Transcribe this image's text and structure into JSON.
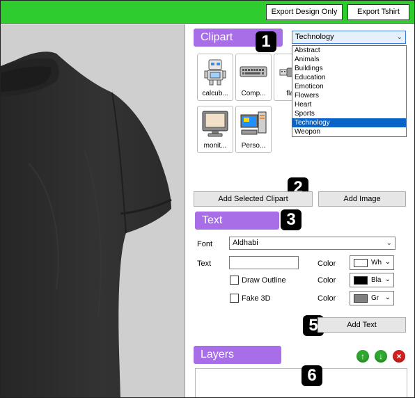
{
  "toolbar": {
    "export_design_label": "Export Design Only",
    "export_tshirt_label": "Export Tshirt"
  },
  "clipart": {
    "header": "Clipart",
    "badge": "1",
    "category_selected": "Technology",
    "categories": [
      "Abstract",
      "Animals",
      "Buildings",
      "Education",
      "Emoticon",
      "Flowers",
      "Heart",
      "Sports",
      "Technology",
      "Weopon"
    ],
    "items": [
      {
        "caption": "calcub...",
        "icon": "robot-clipart-icon"
      },
      {
        "caption": "Comp...",
        "icon": "keyboard-clipart-icon"
      },
      {
        "caption": "flas",
        "icon": "flash-drive-clipart-icon"
      },
      {
        "caption": "monit...",
        "icon": "monitor-clipart-icon"
      },
      {
        "caption": "Perso...",
        "icon": "personal-computer-clipart-icon"
      }
    ],
    "badge2": "2",
    "add_selected_label": "Add Selected Clipart",
    "add_image_label": "Add Image"
  },
  "text": {
    "header": "Text",
    "badge": "3",
    "font_label": "Font",
    "font_value": "Aldhabi",
    "text_label": "Text",
    "text_value": "",
    "draw_outline_label": "Draw Outline",
    "fake3d_label": "Fake 3D",
    "color_label": "Color",
    "colors": [
      {
        "name": "Wh",
        "hex": "#ffffff"
      },
      {
        "name": "Bla",
        "hex": "#000000"
      },
      {
        "name": "Gr",
        "hex": "#808080"
      }
    ],
    "badge5": "5",
    "add_text_label": "Add Text"
  },
  "layers": {
    "header": "Layers",
    "badge": "6",
    "icons": [
      "move-up-icon",
      "move-down-icon",
      "delete-icon"
    ],
    "icon_colors": [
      "#2ea82e",
      "#2ea82e",
      "#d42020"
    ]
  },
  "preview": {
    "shirt_color": "#2f2f2f",
    "background": "#cfcfcf"
  }
}
